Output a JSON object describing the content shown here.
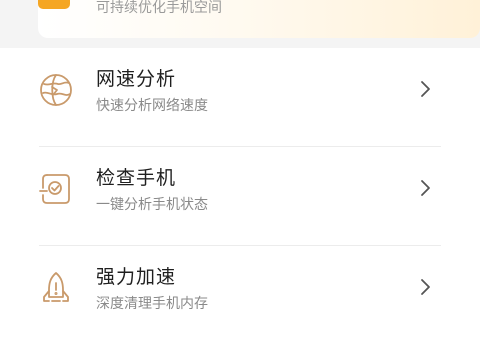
{
  "banner": {
    "subtitle": "可持续优化手机空间"
  },
  "items": [
    {
      "title": "网速分析",
      "subtitle": "快速分析网络速度",
      "icon": "globe-speed-icon"
    },
    {
      "title": "检查手机",
      "subtitle": "一键分析手机状态",
      "icon": "phone-check-icon"
    },
    {
      "title": "强力加速",
      "subtitle": "深度清理手机内存",
      "icon": "rocket-boost-icon"
    }
  ],
  "colors": {
    "icon_stroke": "#c99a6b",
    "banner_accent": "#f5a623",
    "chevron": "#555555"
  }
}
